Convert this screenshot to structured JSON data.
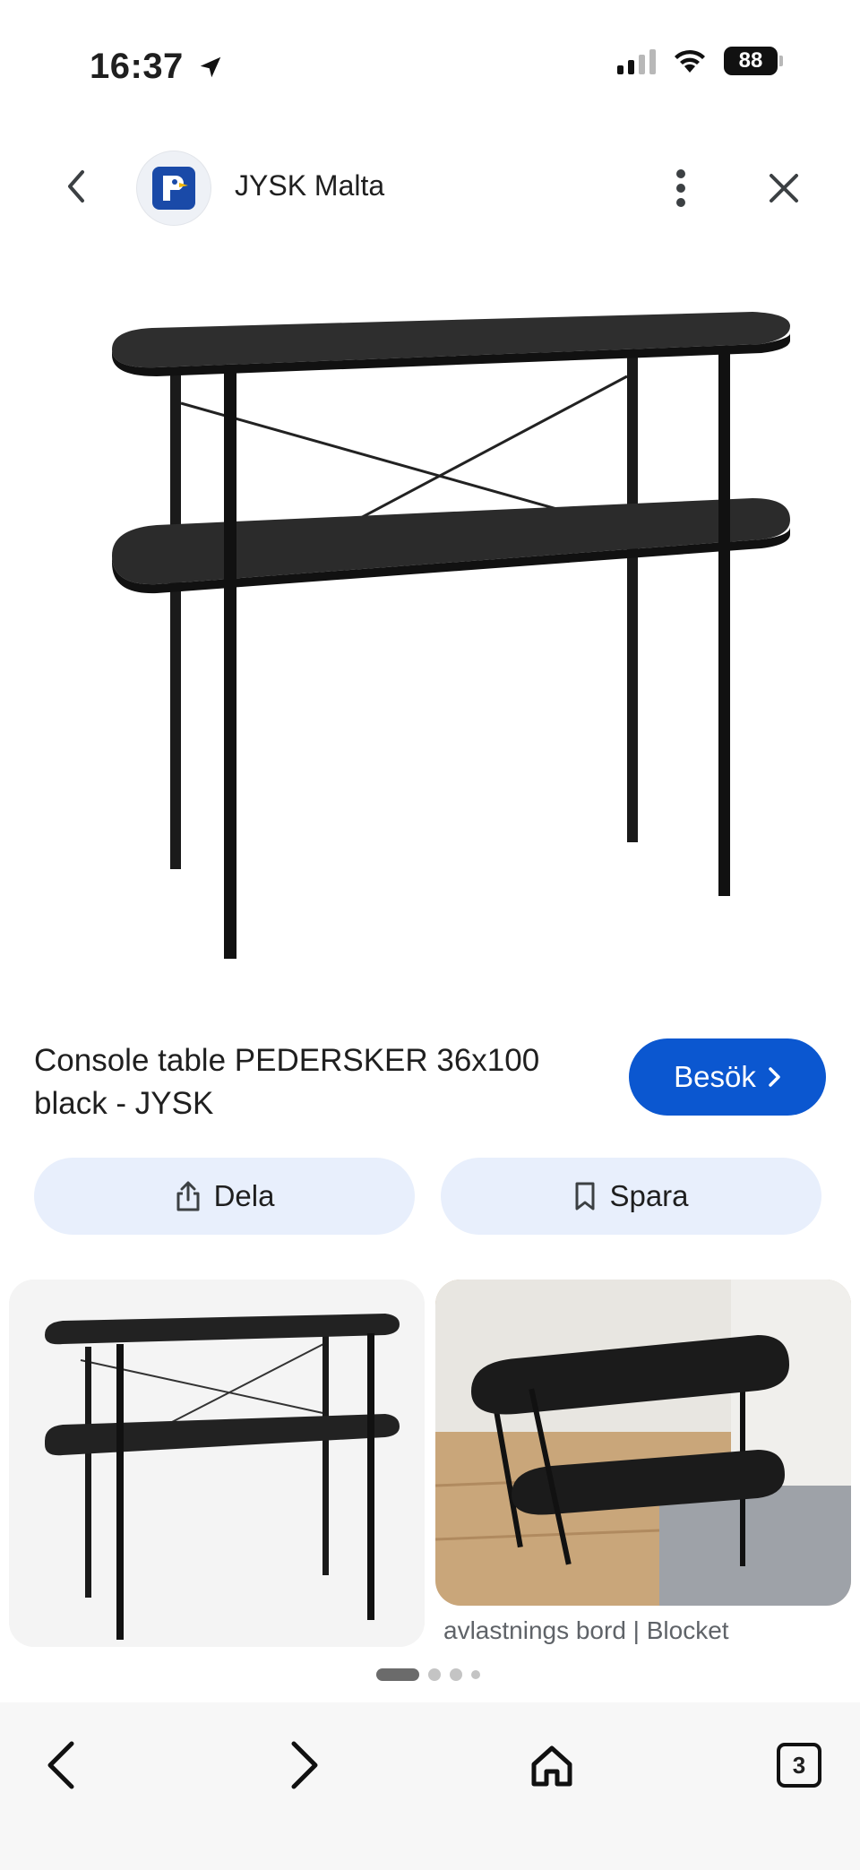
{
  "status_bar": {
    "time": "16:37",
    "battery": "88"
  },
  "header": {
    "site_name": "JYSK Malta"
  },
  "product": {
    "title": "Console table PEDERSKER 36x100 black - JYSK"
  },
  "actions": {
    "visit_label": "Besök",
    "share_label": "Dela",
    "save_label": "Spara"
  },
  "related": [
    {
      "caption": ""
    },
    {
      "caption": "avlastnings bord | Blocket"
    }
  ],
  "bottom_nav": {
    "tab_count": "3"
  },
  "colors": {
    "accent": "#0b57d0",
    "pill_bg": "#e8effc"
  }
}
